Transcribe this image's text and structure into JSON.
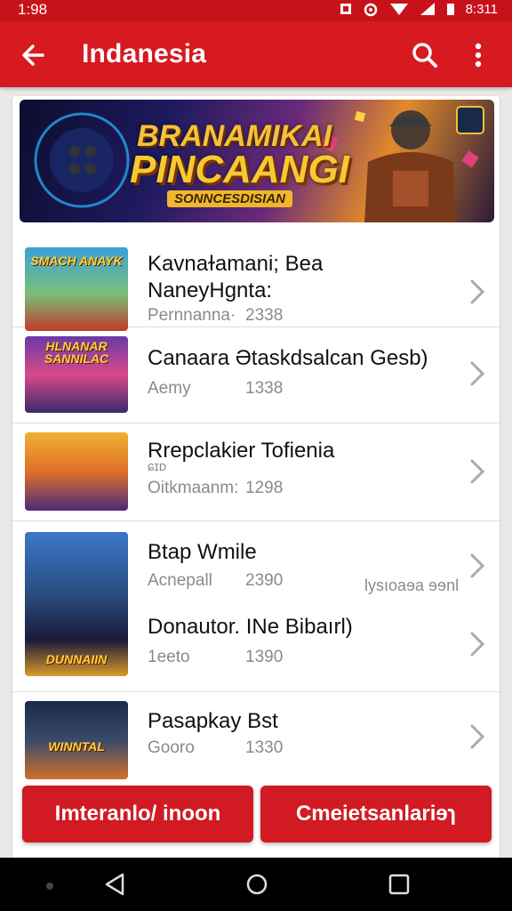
{
  "status_bar": {
    "time": "1:98",
    "clock_right": "8:311",
    "icons": [
      "sim-icon",
      "alarm-icon",
      "wifi-icon",
      "signal-icon",
      "battery-icon"
    ]
  },
  "app_bar": {
    "title": "Indanesia",
    "back_icon": "back-arrow-icon",
    "search_icon": "search-icon",
    "more_icon": "more-vert-icon"
  },
  "banner": {
    "line1": "BRANAMIKAI",
    "line2": "PINCAANGI",
    "subtitle": "SONNCESDISIAN"
  },
  "list": [
    {
      "thumb_label": "SMACH ANAYK",
      "title_1": "Kavnaɫamani; Bea",
      "title_2": "NaneyHgnta:",
      "meta": "Pernnanna·",
      "number": "2338"
    },
    {
      "thumb_label": "HLNANAR SANNILAC",
      "title_1": "Canaara Ətaskdsalcan Gesb)",
      "meta": "Aemy",
      "number": "1338"
    },
    {
      "thumb_label": "",
      "title_1": "Rrepclakier Tofienia",
      "small": "ɕɪᴅ",
      "meta": "Oitkmaanm:",
      "number": "1298"
    },
    {
      "thumb_label": "DUNNAIIN",
      "title_1": "Btap Wmile",
      "meta": "Acnepall",
      "number": "2390",
      "side_note": "lysıoaɘa ɘɘnl",
      "title_2": "Donautor. INe Bibaırl)",
      "meta_2": "1eeto",
      "number_2": "1390"
    },
    {
      "thumb_label": "WINNTAL",
      "title_1": "Pasapkay Bst",
      "meta": "Gooro",
      "number": "1330"
    }
  ],
  "buttons": {
    "left": "Imteranlo/ inoon",
    "right": "Cmeietsanlariɘɿ"
  },
  "colors": {
    "primary": "#d71920",
    "status": "#c8121b",
    "button": "#d11a22"
  }
}
